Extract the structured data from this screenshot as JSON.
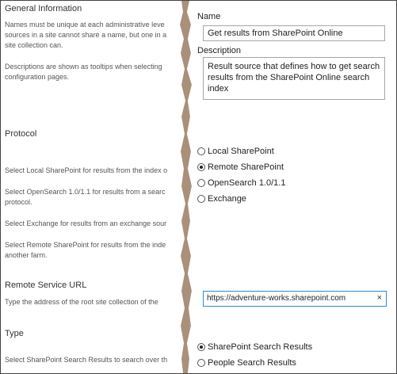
{
  "general": {
    "title": "General Information",
    "help_lines": [
      "Names must be unique at each administrative leve",
      "sources in a site cannot share a name, but one in a",
      "site collection can."
    ],
    "help2_lines": [
      "Descriptions are shown as tooltips when selecting",
      "configuration pages."
    ]
  },
  "protocol": {
    "title": "Protocol",
    "help_local": "Select Local SharePoint for results from the index o",
    "help_opensearch": [
      "Select OpenSearch 1.0/1.1 for results from a searc",
      "protocol."
    ],
    "help_exchange": "Select Exchange for results from an exchange sour",
    "help_remote": [
      "Select Remote SharePoint for results from the inde",
      "another farm."
    ],
    "options": [
      {
        "label": "Local SharePoint",
        "selected": false
      },
      {
        "label": "Remote SharePoint",
        "selected": true
      },
      {
        "label": "OpenSearch 1.0/1.1",
        "selected": false
      },
      {
        "label": "Exchange",
        "selected": false
      }
    ]
  },
  "remote_url": {
    "title": "Remote Service URL",
    "help": "Type the address of the root site collection of the",
    "value": "https://adventure-works.sharepoint.com",
    "clear_glyph": "×"
  },
  "type": {
    "title": "Type",
    "help": "Select SharePoint Search Results to search over th",
    "options": [
      {
        "label": "SharePoint Search Results",
        "selected": true
      },
      {
        "label": "People Search Results",
        "selected": false
      }
    ]
  },
  "form": {
    "name_label": "Name",
    "name_value": "Get results from SharePoint Online",
    "description_label": "Description",
    "description_lines": [
      "Result source that defines how to get search",
      "results from the SharePoint Online search index"
    ]
  }
}
